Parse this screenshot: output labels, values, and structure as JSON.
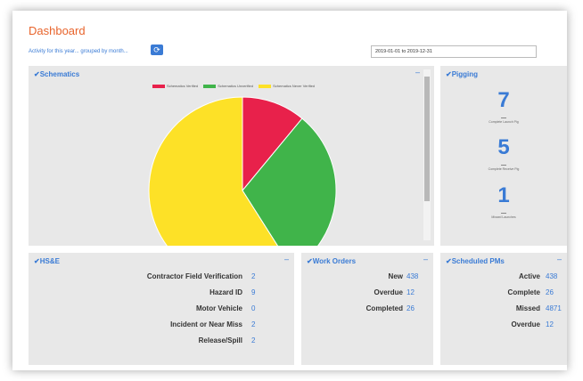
{
  "header": {
    "title": "Dashboard",
    "activity_label": "Activity for this year... grouped by month...",
    "refresh_icon": "refresh-icon",
    "date_range": "2019-01-01 to 2019-12-31"
  },
  "schematics": {
    "title": "Schematics",
    "collapse": "–",
    "legend": [
      {
        "label": "Schematics Verified",
        "color": "#e8214b"
      },
      {
        "label": "Schematics Unverified",
        "color": "#40b44a"
      },
      {
        "label": "Schematics Never Verified",
        "color": "#fde127"
      }
    ],
    "chart_data": {
      "type": "pie",
      "categories": [
        "Schematics Verified",
        "Schematics Unverified",
        "Schematics Never Verified"
      ],
      "values": [
        11,
        30,
        59
      ]
    }
  },
  "pigging": {
    "title": "Pigging",
    "items": [
      {
        "value": "7",
        "label": "Complete Launch Pig"
      },
      {
        "value": "5",
        "label": "Complete Receive Pig"
      },
      {
        "value": "1",
        "label": "Missed Launches"
      }
    ]
  },
  "hse": {
    "title": "HS&E",
    "collapse": "–",
    "rows": [
      {
        "label": "Contractor Field Verification",
        "value": "2"
      },
      {
        "label": "Hazard ID",
        "value": "9"
      },
      {
        "label": "Motor Vehicle",
        "value": "0"
      },
      {
        "label": "Incident or Near Miss",
        "value": "2"
      },
      {
        "label": "Release/Spill",
        "value": "2"
      }
    ]
  },
  "work_orders": {
    "title": "Work Orders",
    "collapse": "–",
    "rows": [
      {
        "label": "New",
        "value": "438"
      },
      {
        "label": "Overdue",
        "value": "12"
      },
      {
        "label": "Completed",
        "value": "26"
      }
    ]
  },
  "scheduled_pms": {
    "title": "Scheduled PMs",
    "collapse": "–",
    "rows": [
      {
        "label": "Active",
        "value": "438"
      },
      {
        "label": "Complete",
        "value": "26"
      },
      {
        "label": "Missed",
        "value": "4871"
      },
      {
        "label": "Overdue",
        "value": "12"
      }
    ]
  }
}
